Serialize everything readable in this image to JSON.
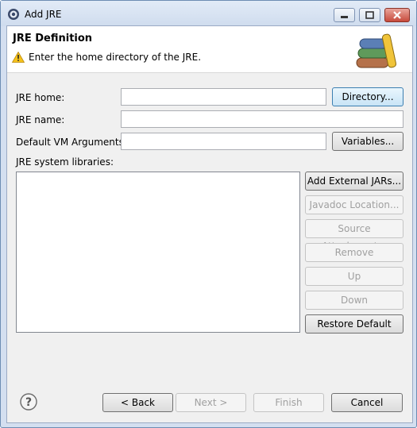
{
  "window": {
    "title": "Add JRE"
  },
  "header": {
    "title": "JRE Definition",
    "message": "Enter the home directory of the JRE."
  },
  "form": {
    "jre_home_label": "JRE home:",
    "jre_home_value": "",
    "jre_name_label": "JRE name:",
    "jre_name_value": "",
    "vm_args_label": "Default VM Arguments:",
    "vm_args_value": "",
    "libraries_label": "JRE system libraries:",
    "directory_button": "Directory...",
    "variables_button": "Variables..."
  },
  "library_buttons": {
    "add_external_jars": "Add External JARs...",
    "javadoc_location": "Javadoc Location...",
    "source_attachment": "Source Attachment...",
    "remove": "Remove",
    "up": "Up",
    "down": "Down",
    "restore_default": "Restore Default"
  },
  "footer": {
    "back": "< Back",
    "next": "Next >",
    "finish": "Finish",
    "cancel": "Cancel"
  },
  "colors": {
    "titlebar": "#d6e2f2",
    "dialog_bg": "#f0f0f0",
    "warning": "#f5c21b"
  }
}
